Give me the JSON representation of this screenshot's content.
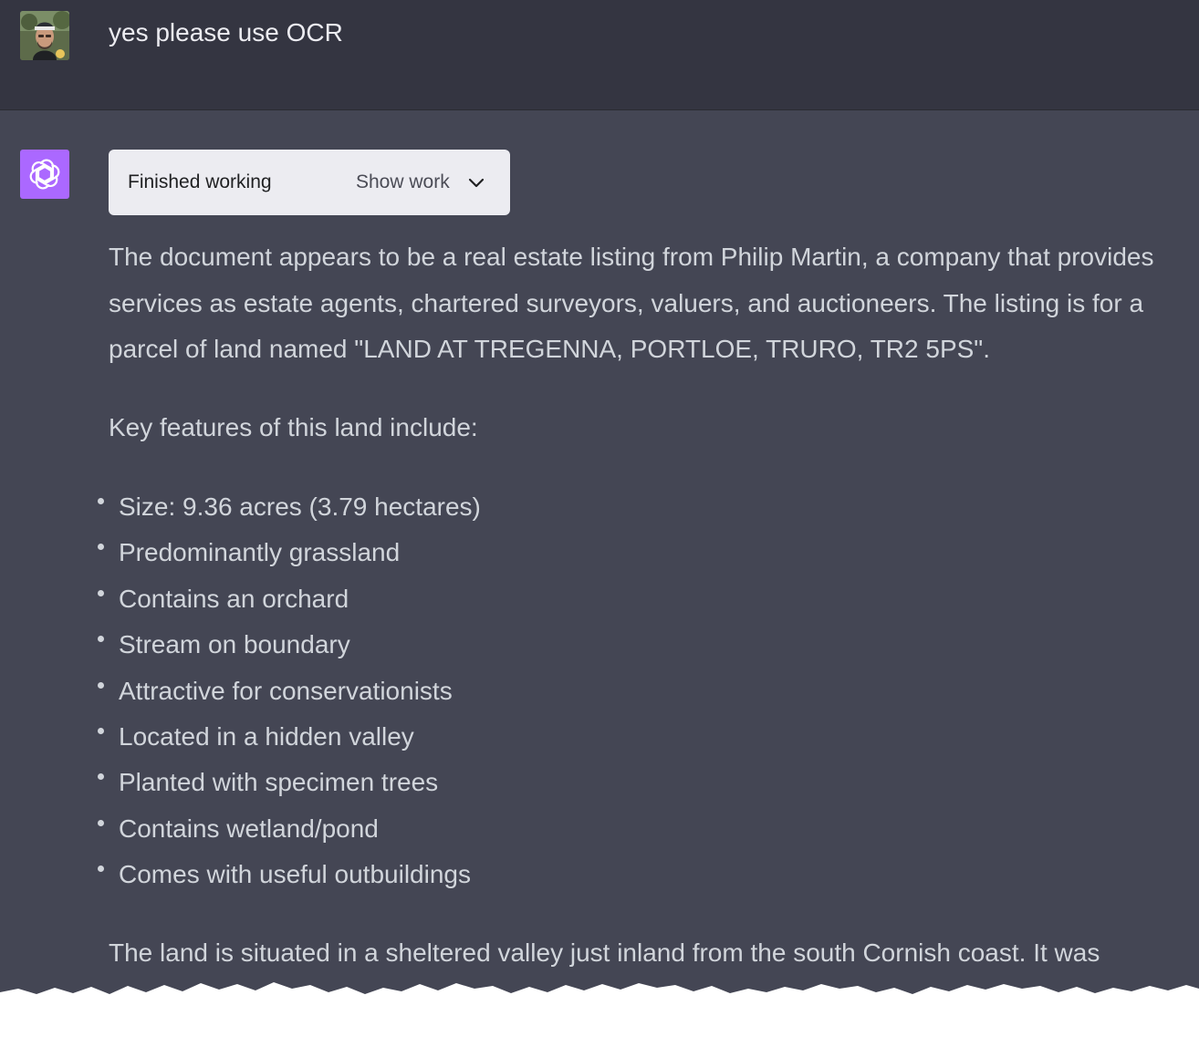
{
  "user_message": {
    "text": "yes please use OCR"
  },
  "assistant_message": {
    "status": {
      "label": "Finished working",
      "show_work_label": "Show work"
    },
    "paragraph_1": "The document appears to be a real estate listing from Philip Martin, a company that provides services as estate agents, chartered surveyors, valuers, and auctioneers. The listing is for a parcel of land named \"LAND AT TREGENNA, PORTLOE, TRURO, TR2 5PS\".",
    "paragraph_2": "Key features of this land include:",
    "features": [
      "Size: 9.36 acres (3.79 hectares)",
      "Predominantly grassland",
      "Contains an orchard",
      "Stream on boundary",
      "Attractive for conservationists",
      "Located in a hidden valley",
      "Planted with specimen trees",
      "Contains wetland/pond",
      "Comes with useful outbuildings"
    ],
    "paragraph_3": "The land is situated in a sheltered valley just inland from the south Cornish coast. It was"
  },
  "icons": {
    "assistant_avatar": "openai-logo-icon",
    "chevron": "chevron-down-icon"
  },
  "colors": {
    "user_bg": "#343541",
    "assistant_bg": "#444654",
    "avatar_accent": "#ab68ff",
    "text": "#d1d5db",
    "pill_bg": "#ececf1"
  }
}
